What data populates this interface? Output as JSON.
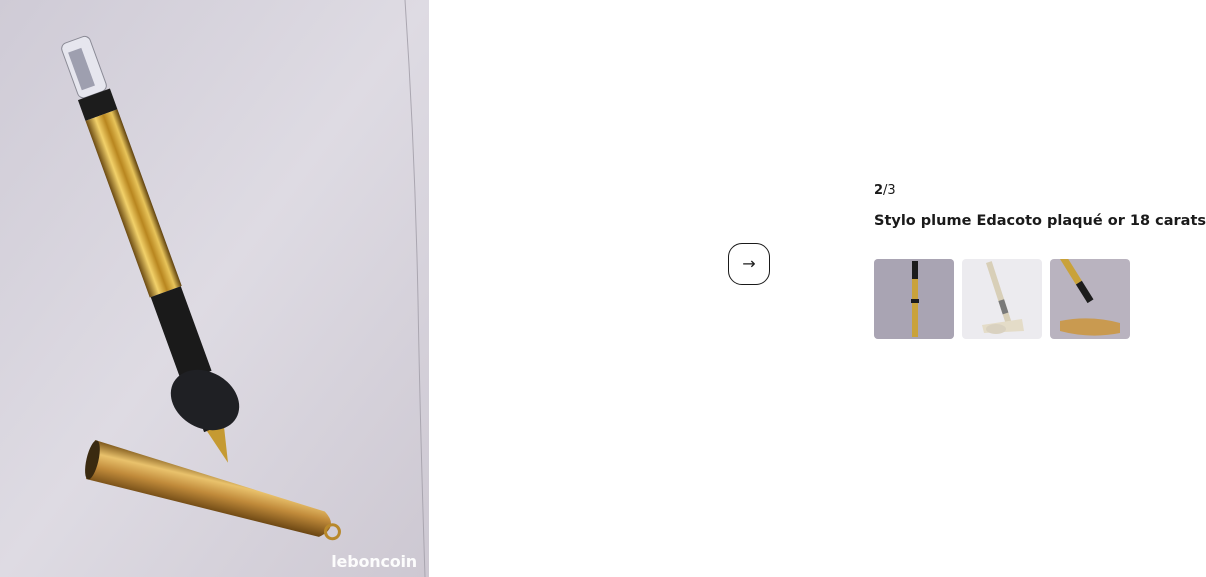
{
  "gallery": {
    "counter_current": "2",
    "counter_total": "/3",
    "title": "Stylo plume Edacoto plaqué or 18 carats",
    "watermark": "leboncoin",
    "next_icon": "arrow-right-icon",
    "thumbnails": [
      {
        "alt": "pen-thumbnail-1"
      },
      {
        "alt": "pen-thumbnail-2"
      },
      {
        "alt": "pen-thumbnail-3"
      }
    ]
  },
  "colors": {
    "text": "#1a1a1a",
    "background": "#ffffff",
    "gold": "#c9a23a"
  }
}
